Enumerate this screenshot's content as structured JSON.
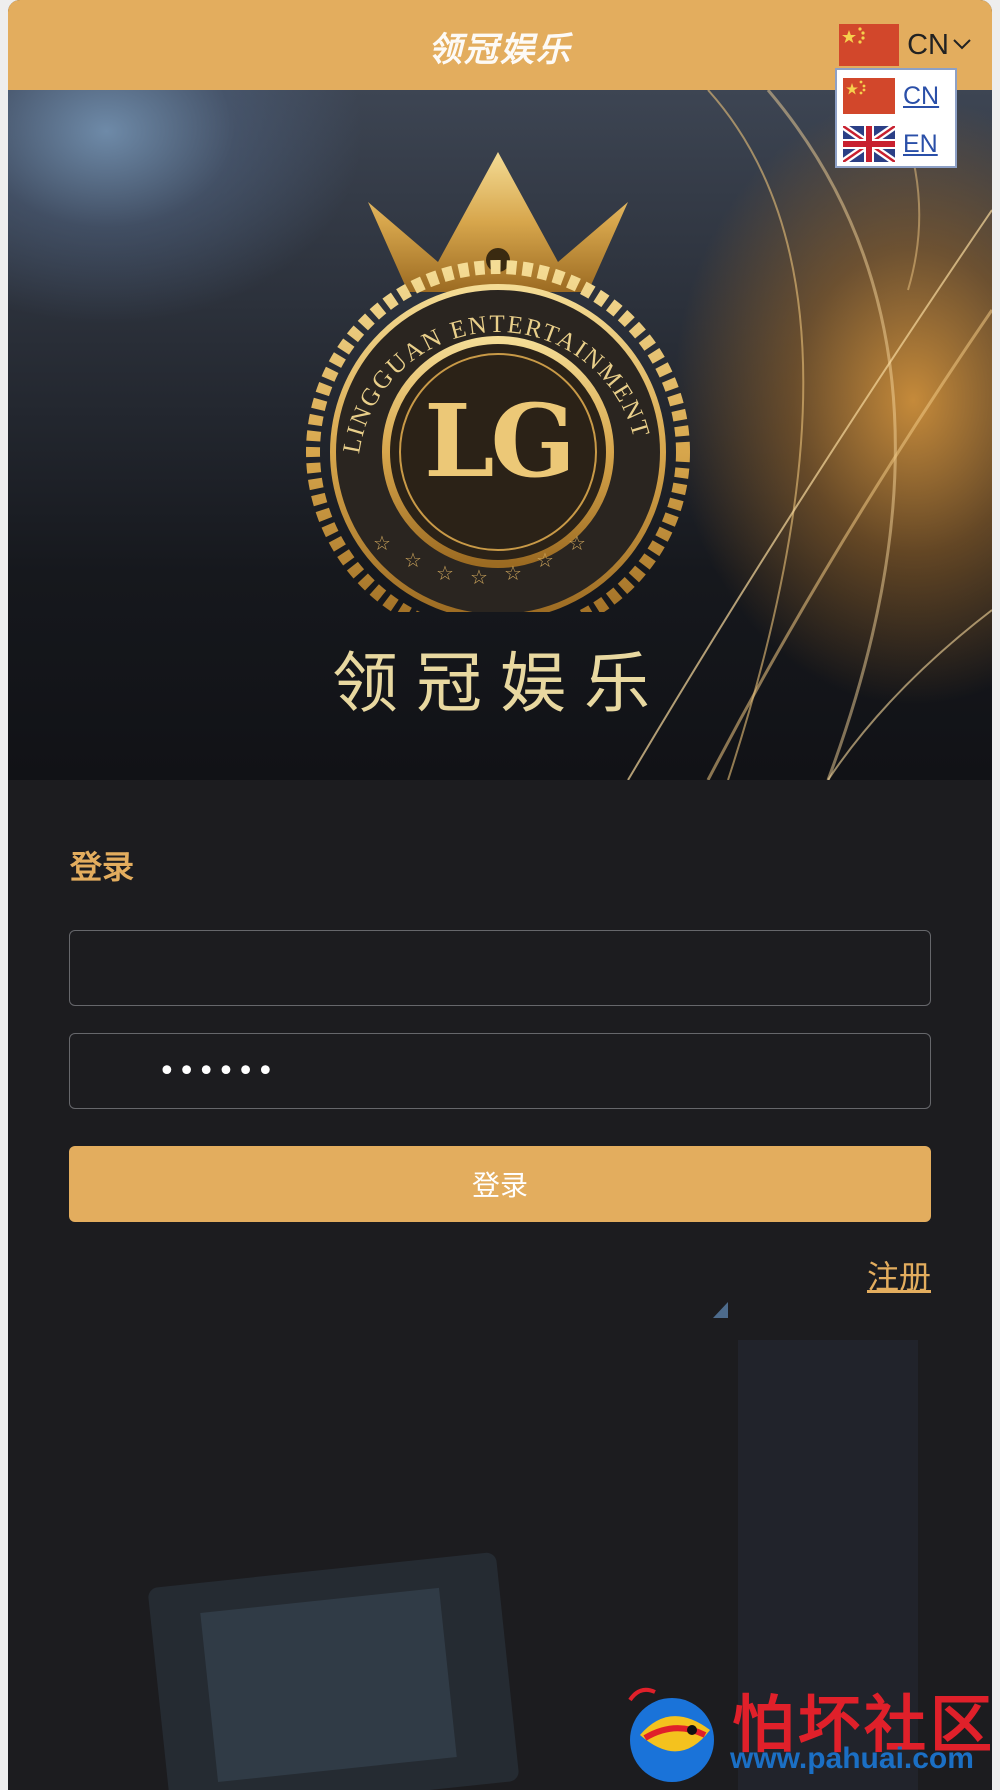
{
  "header": {
    "app_title": "领冠娱乐",
    "language_current": "CN",
    "language_options": [
      "CN",
      "EN"
    ]
  },
  "hero": {
    "emblem_letters": "LG",
    "emblem_ring_text": "LINGGUAN ENTERTAINMENT",
    "subtitle": "领冠娱乐"
  },
  "login": {
    "heading": "登录",
    "username_value": "",
    "password_value": "••••••",
    "submit_label": "登录",
    "register_label": "注册"
  },
  "watermark": {
    "title": "怕坏社区",
    "url": "www.pahuai.com"
  },
  "colors": {
    "accent": "#e3ad5e",
    "background": "#1c1c1f",
    "link_blue": "#2a4fa8"
  },
  "icons": [
    "chevron-down-icon",
    "flag-cn-icon",
    "flag-uk-icon",
    "crown-icon",
    "fish-logo-icon"
  ]
}
